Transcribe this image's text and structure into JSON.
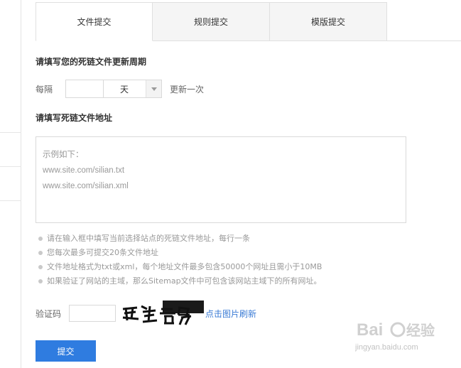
{
  "tabs": [
    {
      "label": "文件提交",
      "active": true
    },
    {
      "label": "规则提交",
      "active": false
    },
    {
      "label": "模版提交",
      "active": false
    }
  ],
  "period": {
    "title": "请填写您的死链文件更新周期",
    "prefix": "每隔",
    "value": "",
    "unit": "天",
    "suffix": "更新一次"
  },
  "address": {
    "title": "请填写死链文件地址",
    "placeholder_lines": [
      "示例如下：",
      "www.site.com/silian.txt",
      "www.site.com/silian.xml"
    ]
  },
  "tips": [
    "请在输入框中填写当前选择站点的死链文件地址，每行一条",
    "您每次最多可提交20条文件地址",
    "文件地址格式为txt或xml，每个地址文件最多包含50000个网址且需小于10MB",
    "如果验证了网站的主域，那么Sitemap文件中可包含该网站主域下的所有网址。"
  ],
  "captcha": {
    "label": "验证码",
    "image_text": "罗利青罗",
    "refresh_label": "点击图片刷新"
  },
  "submit_label": "提交",
  "watermark": {
    "brand": "Bai经验",
    "url": "jingyan.baidu.com"
  },
  "colors": {
    "accent": "#2f7ce0",
    "link": "#3a7bd5"
  }
}
